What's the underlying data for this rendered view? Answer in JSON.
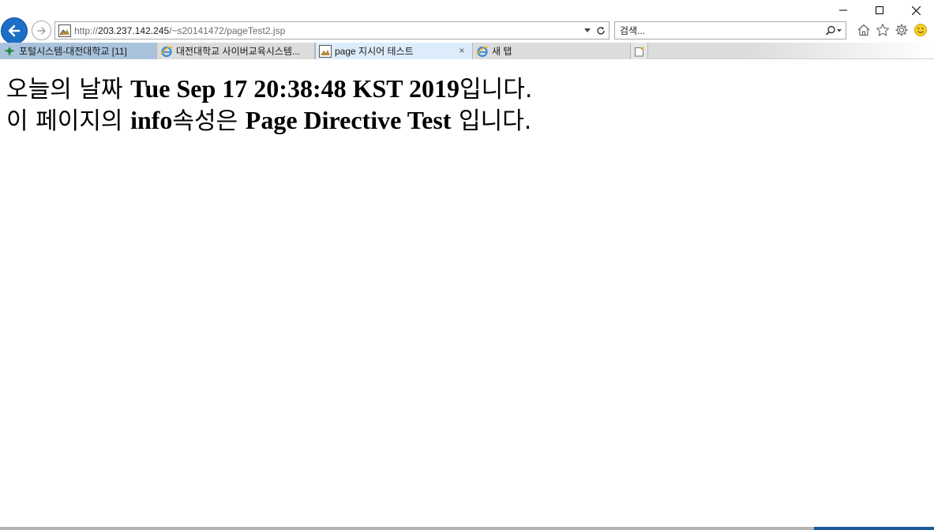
{
  "window": {
    "minimize_icon": "minimize-icon",
    "maximize_icon": "maximize-icon",
    "close_icon": "close-icon"
  },
  "nav": {
    "back_icon": "arrow-left-icon",
    "forward_icon": "arrow-right-icon",
    "address": {
      "scheme": "http://",
      "host": "203.237.142.245",
      "path": "/~s20141472/pageTest2.jsp"
    },
    "dropdown_icon": "chevron-down-icon",
    "refresh_icon": "refresh-icon",
    "search": {
      "placeholder": "검색...",
      "icon": "search-icon"
    },
    "tools": [
      "home-icon",
      "star-icon",
      "gear-icon",
      "smiley-icon"
    ]
  },
  "tabs": [
    {
      "label": "포털시스템-대전대학교 [11]",
      "icon": "leaf-icon"
    },
    {
      "label": "대전대학교 사이버교육시스템...",
      "icon": "ie-icon"
    },
    {
      "label": "page 지시어 테스트",
      "icon": "page-icon",
      "active": true,
      "close": "×"
    },
    {
      "label": "새 탭",
      "icon": "ie-icon"
    }
  ],
  "new_tab_icon": "new-tab-icon",
  "page": {
    "line1": {
      "prefix": "오늘의 날짜 ",
      "value": "Tue Sep 17 20:38:48 KST 2019",
      "suffix": "입니다."
    },
    "line2": {
      "prefix": "이 페이지의 ",
      "value1": "info",
      "middle": "속성은 ",
      "value2": "Page Directive Test",
      "suffix": " 입니다."
    }
  },
  "colors": {
    "back_button": "#1b6fc6",
    "active_tab": "#dcecfa",
    "portal_tab": "#a9c3dc"
  }
}
